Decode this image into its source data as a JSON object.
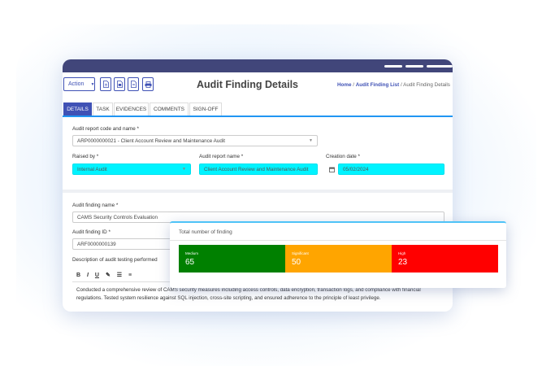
{
  "toolbar": {
    "action_label": "Action",
    "page_title": "Audit Finding Details",
    "breadcrumb": {
      "home": "Home",
      "sep1": "/",
      "list": "Audit Finding List",
      "sep2": "/",
      "current": "Audit Finding Details"
    }
  },
  "tabs": [
    "DETAILS",
    "TASK",
    "EVIDENCES",
    "COMMENTS",
    "SIGN-OFF"
  ],
  "form": {
    "report_code_label": "Audit report code and name *",
    "report_code_value": "ARP0000000021 - Client Account Review and Maintenance Audit",
    "raised_by_label": "Raised by *",
    "raised_by_value": "Internal Audit",
    "report_name_label": "Audit report name *",
    "report_name_value": "Client Account Review and Maintenance Audit",
    "creation_date_label": "Creation date *",
    "creation_date_value": "05/02/2024",
    "finding_name_label": "Audit finding name *",
    "finding_name_value": "CAMS Security Controls Evaluation",
    "finding_id_label": "Audit finding ID *",
    "finding_id_value": "ARF0000000139",
    "description_label": "Description of audit testing performed",
    "description_line1": "Conducted a comprehensive review of CAMS security measures including access controls, data encryption, transaction logs, and compliance with financial",
    "description_line2": "regulations. Tested system resilience against SQL injection, cross-site scripting, and ensured adherence to the principle of least privilege."
  },
  "editor": {
    "bold": "B",
    "italic": "I",
    "underline": "U"
  },
  "findings_summary": {
    "title": "Total number of finding",
    "segments": [
      {
        "name": "Medium",
        "value": "65",
        "color": "#008000"
      },
      {
        "name": "Significant",
        "value": "50",
        "color": "#ffa500"
      },
      {
        "name": "High",
        "value": "23",
        "color": "#ff0000"
      }
    ]
  },
  "colors": {
    "brand": "#3f51b5",
    "titlebar": "#41467a",
    "highlight_field": "#00f3ff",
    "tab_underline": "#2196f3"
  }
}
